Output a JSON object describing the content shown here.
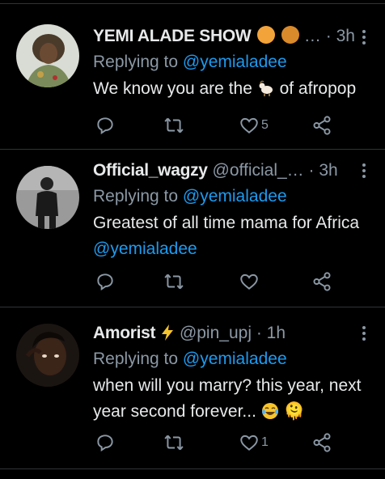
{
  "tweets": [
    {
      "name": "YEMI ALADE SHOW",
      "name_suffix": "…",
      "handle": "",
      "time": "3h",
      "reply_prefix": "Replying to",
      "reply_mention": "@yemialadee",
      "body_before": "We know you are the",
      "body_emoji": "goat-emoji",
      "body_after": "of afropop",
      "body_mention": "",
      "likes": "5",
      "header_emojis": [
        "tiger-emoji",
        "lion-emoji"
      ]
    },
    {
      "name": "Official_wagzy",
      "handle": "@official_…",
      "time": "3h",
      "reply_prefix": "Replying to",
      "reply_mention": "@yemialadee",
      "body_text": "Greatest of all time mama for Africa",
      "body_mention": "@yemialadee",
      "likes": ""
    },
    {
      "name": "Amorist",
      "name_emoji": "lightning-emoji",
      "handle": "@pin_upj",
      "time": "1h",
      "reply_prefix": "Replying to",
      "reply_mention": "@yemialadee",
      "body_text": "when will you marry? this year, next year second forever...",
      "body_emoji": "laughing-tears-emoji",
      "body_tail": "🫠",
      "likes": "1"
    }
  ],
  "colors": {
    "background": "#000000",
    "text": "#e7e9ea",
    "muted": "#8b98a5",
    "link": "#1d9bf0",
    "divider": "#2f3336"
  },
  "separator": "·"
}
